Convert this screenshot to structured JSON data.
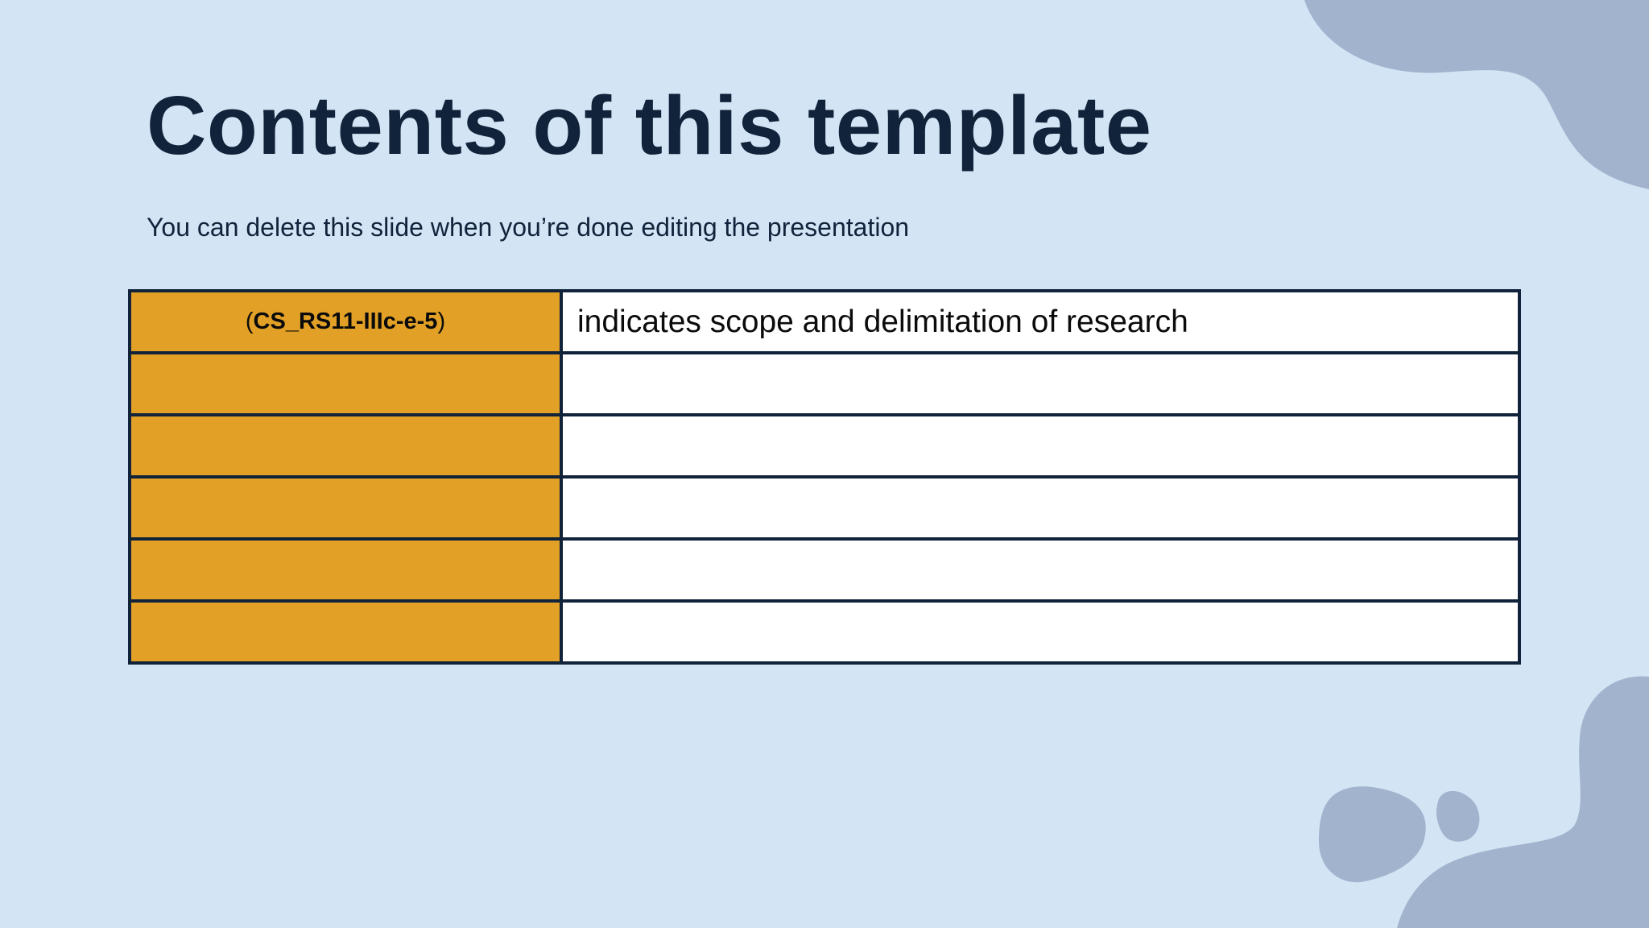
{
  "slide": {
    "title": "Contents of this template",
    "subtitle": "You can delete this slide when you’re done editing the presentation",
    "colors": {
      "background": "#d3e5f5",
      "blob": "#a2b3cd",
      "title_text": "#10233a",
      "code_cell": "#e2a126",
      "desc_cell": "#ffffff",
      "table_border": "#10233a"
    }
  },
  "table": {
    "rows": [
      {
        "code_open": "(",
        "code": "CS_RS11-IIIc-e-5",
        "code_close": ")",
        "description": "indicates scope and delimitation of research"
      },
      {
        "code_open": "",
        "code": "",
        "code_close": "",
        "description": ""
      },
      {
        "code_open": "",
        "code": "",
        "code_close": "",
        "description": ""
      },
      {
        "code_open": "",
        "code": "",
        "code_close": "",
        "description": ""
      },
      {
        "code_open": "",
        "code": "",
        "code_close": "",
        "description": ""
      },
      {
        "code_open": "",
        "code": "",
        "code_close": "",
        "description": ""
      }
    ]
  }
}
